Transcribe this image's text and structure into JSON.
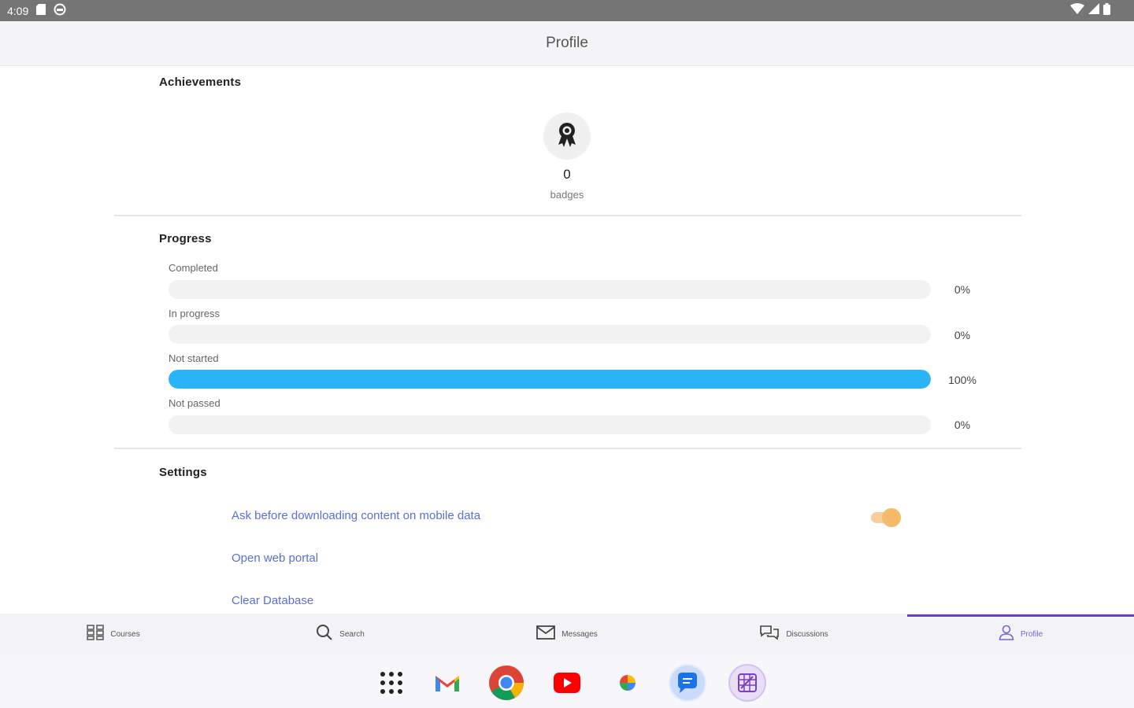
{
  "status_bar": {
    "time": "4:09"
  },
  "header": {
    "title": "Profile"
  },
  "achievements": {
    "title": "Achievements",
    "badge_count": "0",
    "badge_label": "badges"
  },
  "progress": {
    "title": "Progress",
    "rows": [
      {
        "label": "Completed",
        "percent_text": "0%",
        "value": 0
      },
      {
        "label": "In progress",
        "percent_text": "0%",
        "value": 0
      },
      {
        "label": "Not started",
        "percent_text": "100%",
        "value": 100
      },
      {
        "label": "Not passed",
        "percent_text": "0%",
        "value": 0
      }
    ],
    "fill_color": "#2bb4f5"
  },
  "settings": {
    "title": "Settings",
    "items": [
      {
        "label": "Ask before downloading content on mobile data",
        "toggle_on": true
      },
      {
        "label": "Open web portal"
      },
      {
        "label": "Clear Database"
      }
    ],
    "link_color": "#5a6fd8",
    "toggle_color": "#f5b96a"
  },
  "bottom_nav": {
    "items": [
      {
        "label": "Courses",
        "icon": "grid-icon"
      },
      {
        "label": "Search",
        "icon": "search-icon"
      },
      {
        "label": "Messages",
        "icon": "mail-icon"
      },
      {
        "label": "Discussions",
        "icon": "chat-bubbles-icon"
      },
      {
        "label": "Profile",
        "icon": "person-icon",
        "active": true
      }
    ],
    "active_color": "#6a3fd0"
  },
  "dock": {
    "apps": [
      "app-drawer-icon",
      "gmail-icon",
      "chrome-icon",
      "youtube-icon",
      "photos-icon",
      "messages-icon",
      "calendar-app-icon"
    ]
  }
}
